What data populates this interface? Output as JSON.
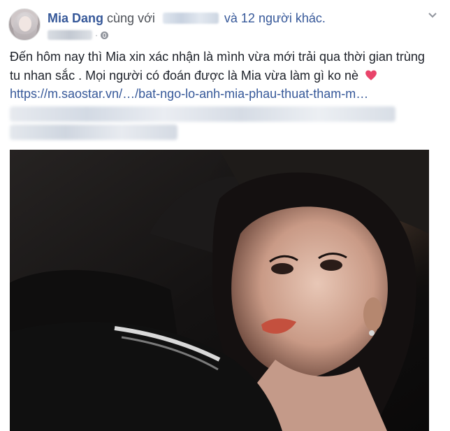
{
  "post": {
    "author": "Mia Dang",
    "with_text": "cùng với",
    "others_text": "và 12 người khác.",
    "body": "Đến hôm nay thì Mia xin xác nhận là mình vừa mới trải qua thời gian trùng tu nhan sắc . Mọi người có đoán được là Mia vừa làm gì ko nè",
    "link": "https://m.saostar.vn/…/bat-ngo-lo-anh-mia-phau-thuat-tham-m…"
  },
  "icons": {
    "privacy": "globe-icon",
    "menu": "chevron-down-icon",
    "emoji": "heart-icon"
  },
  "colors": {
    "link": "#365899",
    "text": "#1d2129",
    "heart": "#e9446a"
  }
}
